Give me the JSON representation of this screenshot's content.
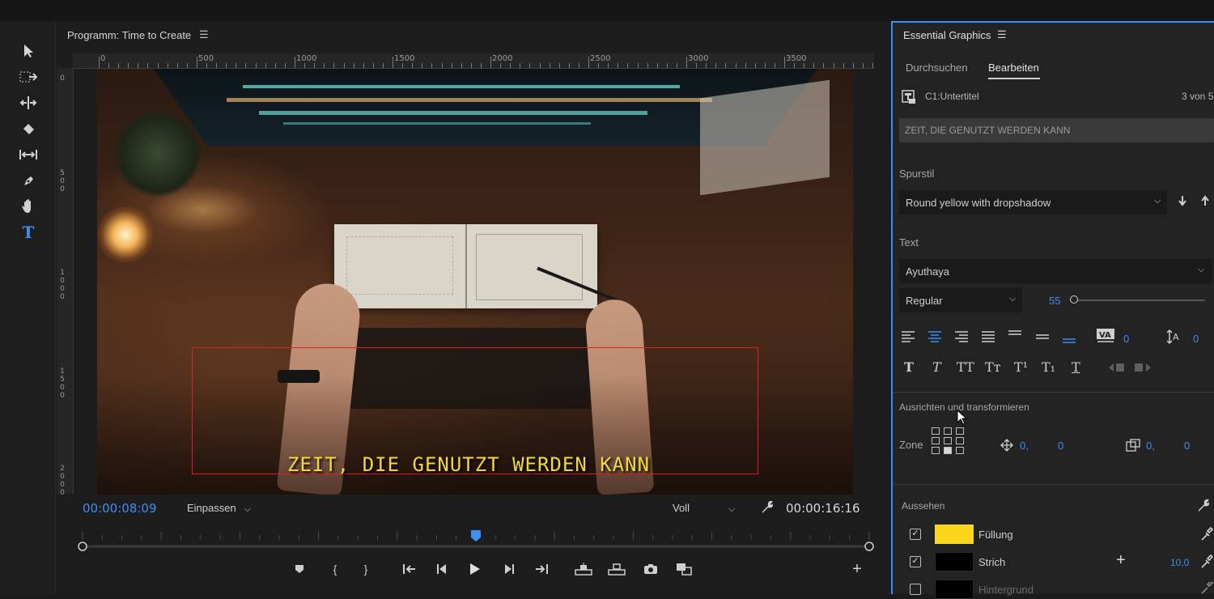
{
  "program_monitor": {
    "title": "Programm: Time to Create",
    "menu_icon": "hamburger-icon",
    "ruler_top": [
      "0",
      "500",
      "1000",
      "1500",
      "2000",
      "2500",
      "3000",
      "3500"
    ],
    "ruler_left": [
      "0",
      "500",
      "1000",
      "1500",
      "2000"
    ],
    "caption": "ZEIT, DIE GENUTZT WERDEN KANN",
    "current_timecode": "00:00:08:09",
    "zoom": "Einpassen",
    "quality": "Voll",
    "duration_timecode": "00:00:16:16",
    "playhead_fraction": 0.5,
    "safe_box_color": "#e02020",
    "caption_color": "#f3d83a"
  },
  "tools": [
    {
      "name": "selection-tool-icon"
    },
    {
      "name": "track-select-tool-icon"
    },
    {
      "name": "ripple-edit-tool-icon"
    },
    {
      "name": "razor-tool-icon"
    },
    {
      "name": "slip-tool-icon"
    },
    {
      "name": "pen-tool-icon"
    },
    {
      "name": "hand-tool-icon"
    },
    {
      "name": "type-tool-icon",
      "label": "T"
    }
  ],
  "essential_graphics": {
    "title": "Essential Graphics",
    "tabs": [
      "Durchsuchen",
      "Bearbeiten"
    ],
    "active_tab": "Bearbeiten",
    "layer_name": "C1:Untertitel",
    "layer_count": "3 von 5",
    "text_value": "ZEIT, DIE GENUTZT WERDEN KANN",
    "track_style_label": "Spurstil",
    "track_style_value": "Round yellow with dropshadow",
    "text_section_label": "Text",
    "font": "Ayuthaya",
    "font_style": "Regular",
    "font_size": "55",
    "font_size_fraction": 0.0,
    "tracking": "0",
    "leading": "0",
    "style_buttons": [
      "T",
      "T",
      "TT",
      "Tт",
      "T¹",
      "T₁",
      "T"
    ],
    "align_section_label": "Ausrichten und transformieren",
    "zone_label": "Zone",
    "position_x": "0,",
    "position_y": "0",
    "anchor_x": "0,",
    "anchor_y": "0",
    "appearance_label": "Aussehen",
    "fill_label": "Füllung",
    "fill_color": "#f9d71c",
    "stroke_label": "Strich",
    "stroke_color": "#000000",
    "stroke_width": "10,0",
    "background_label": "Hintergrund",
    "accent_color": "#3f8ef5"
  }
}
